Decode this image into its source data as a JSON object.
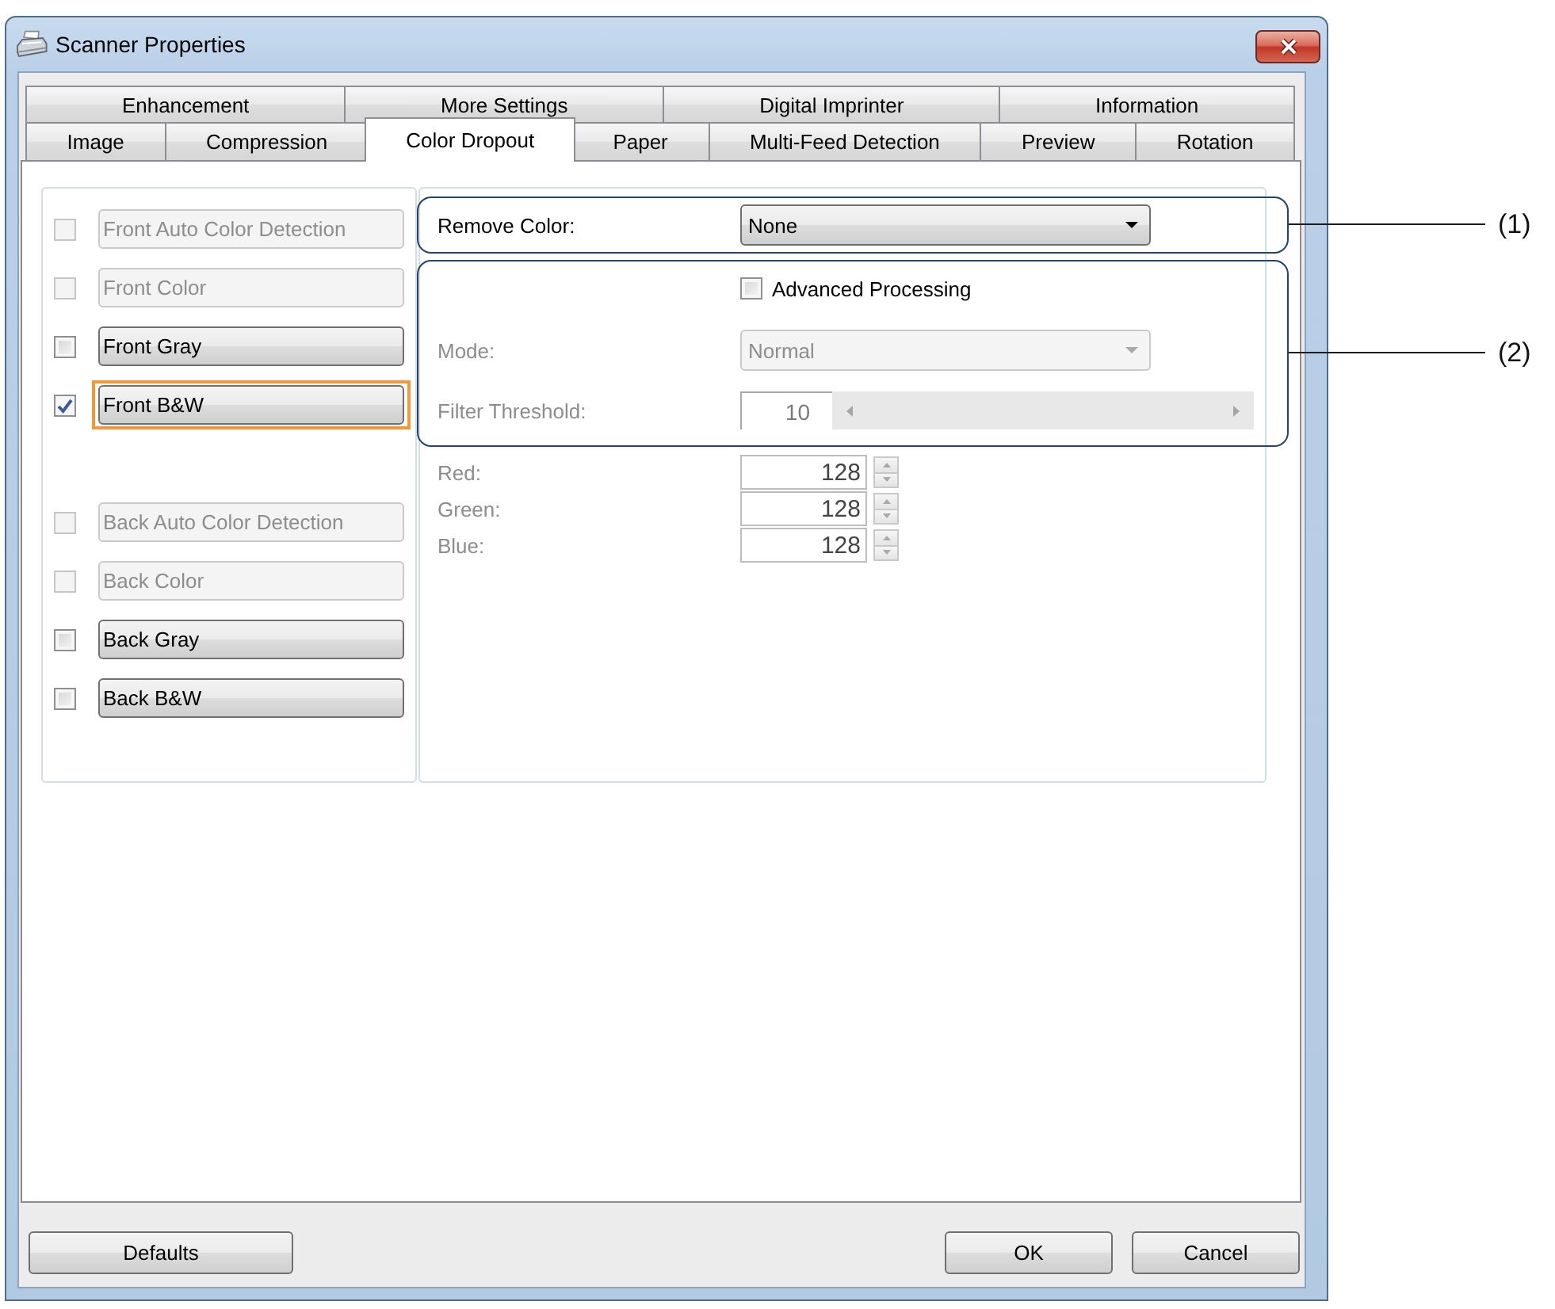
{
  "window": {
    "title": "Scanner Properties"
  },
  "tab_rows": [
    {
      "tabs": [
        {
          "label": "Enhancement",
          "selected": false
        },
        {
          "label": "More Settings",
          "selected": false
        },
        {
          "label": "Digital Imprinter",
          "selected": false
        },
        {
          "label": "Information",
          "selected": false
        }
      ]
    },
    {
      "tabs": [
        {
          "label": "Image",
          "selected": false
        },
        {
          "label": "Compression",
          "selected": false
        },
        {
          "label": "Color Dropout",
          "selected": true
        },
        {
          "label": "Paper",
          "selected": false
        },
        {
          "label": "Multi-Feed Detection",
          "selected": false
        },
        {
          "label": "Preview",
          "selected": false
        },
        {
          "label": "Rotation",
          "selected": false
        }
      ]
    }
  ],
  "image_groups": [
    {
      "items": [
        {
          "label": "Front Auto Color Detection",
          "checked": false,
          "disabled": true,
          "selected": false
        },
        {
          "label": "Front Color",
          "checked": false,
          "disabled": true,
          "selected": false
        },
        {
          "label": "Front Gray",
          "checked": false,
          "disabled": false,
          "selected": false
        },
        {
          "label": "Front B&W",
          "checked": true,
          "disabled": false,
          "selected": true
        }
      ]
    },
    {
      "items": [
        {
          "label": "Back Auto Color Detection",
          "checked": false,
          "disabled": true,
          "selected": false
        },
        {
          "label": "Back Color",
          "checked": false,
          "disabled": true,
          "selected": false
        },
        {
          "label": "Back Gray",
          "checked": false,
          "disabled": false,
          "selected": false
        },
        {
          "label": "Back B&W",
          "checked": false,
          "disabled": false,
          "selected": false
        }
      ]
    }
  ],
  "remove_color": {
    "callout": "(1)",
    "label": "Remove Color:",
    "value": "None",
    "disabled": false
  },
  "processing": {
    "callout": "(2)",
    "advanced": {
      "label": "Advanced Processing",
      "checked": false,
      "disabled": false
    },
    "mode": {
      "label": "Mode:",
      "value": "Normal",
      "disabled": true
    },
    "filter_threshold": {
      "label": "Filter Threshold:",
      "value": "10",
      "disabled": true
    }
  },
  "color_values": [
    {
      "label": "Red:",
      "value": "128",
      "disabled": true
    },
    {
      "label": "Green:",
      "value": "128",
      "disabled": true
    },
    {
      "label": "Blue:",
      "value": "128",
      "disabled": true
    }
  ],
  "footer": {
    "left": [
      "Defaults"
    ],
    "right": [
      "OK",
      "Cancel"
    ]
  }
}
